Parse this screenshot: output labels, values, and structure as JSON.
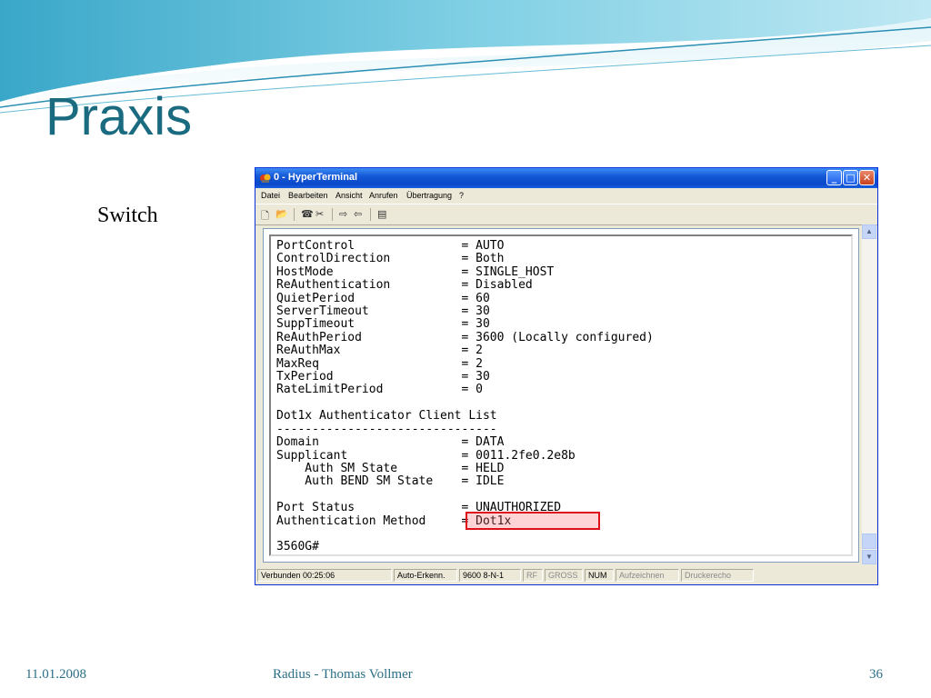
{
  "slide": {
    "title": "Praxis",
    "subtitle": "Switch",
    "footer": {
      "date": "11.01.2008",
      "center": "Radius - Thomas Vollmer",
      "page": "36"
    }
  },
  "window": {
    "title": "0 - HyperTerminal",
    "icon": "hyperterminal-icon",
    "buttons": {
      "minimize": "_",
      "maximize": "□",
      "close": "✕"
    },
    "menu": [
      "Datei",
      "Bearbeiten",
      "Ansicht",
      "Anrufen",
      "Übertragung",
      "?"
    ],
    "toolbar_icons": [
      "new-icon",
      "open-icon",
      "call-icon",
      "disconnect-icon",
      "send-icon",
      "receive-icon",
      "properties-icon"
    ],
    "terminal_lines": [
      "PortControl               = AUTO",
      "ControlDirection          = Both",
      "HostMode                  = SINGLE_HOST",
      "ReAuthentication          = Disabled",
      "QuietPeriod               = 60",
      "ServerTimeout             = 30",
      "SuppTimeout               = 30",
      "ReAuthPeriod              = 3600 (Locally configured)",
      "ReAuthMax                 = 2",
      "MaxReq                    = 2",
      "TxPeriod                  = 30",
      "RateLimitPeriod           = 0",
      "",
      "Dot1x Authenticator Client List",
      "-------------------------------",
      "Domain                    = DATA",
      "Supplicant                = 0011.2fe0.2e8b",
      "    Auth SM State         = HELD",
      "    Auth BEND SM State    = IDLE",
      "",
      "Port Status               = UNAUTHORIZED",
      "Authentication Method     = Dot1x",
      "",
      "3560G#"
    ],
    "status_bar": {
      "connected": "Verbunden 00:25:06",
      "detect": "Auto-Erkenn.",
      "settings": "9600 8-N-1",
      "scroll": "RF",
      "caps": "GROSS",
      "num": "NUM",
      "capture": "Aufzeichnen",
      "print": "Druckerecho"
    }
  }
}
